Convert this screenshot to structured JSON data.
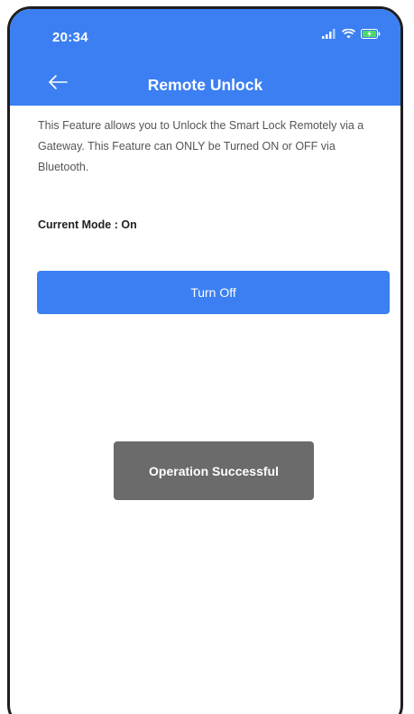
{
  "status_bar": {
    "time": "20:34",
    "icons": [
      "signal-icon",
      "wifi-icon",
      "battery-charging-icon"
    ]
  },
  "header": {
    "title": "Remote Unlock",
    "back_icon": "back-arrow-icon"
  },
  "content": {
    "description": "This Feature allows you to Unlock the Smart Lock Remotely via a Gateway. This Feature can ONLY be Turned ON or OFF via Bluetooth.",
    "mode_label": "Current Mode : On",
    "button_label": "Turn Off"
  },
  "toast": {
    "message": "Operation Successful"
  },
  "colors": {
    "primary": "#3b7ff2",
    "toast_background": "#6b6b6b",
    "battery_charging": "#4cd964"
  }
}
